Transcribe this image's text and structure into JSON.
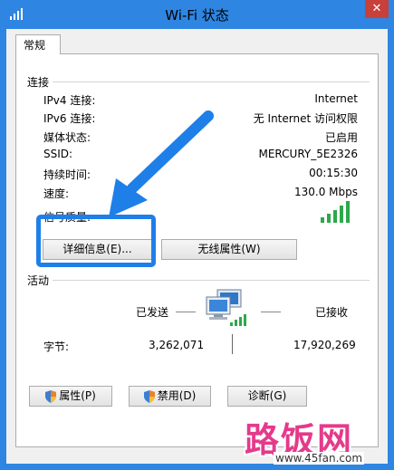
{
  "window": {
    "title": "Wi-Fi 状态",
    "close_glyph": "✕",
    "accent_color": "#2f86e2"
  },
  "tab": {
    "label": "常规"
  },
  "connection": {
    "group_title": "连接",
    "rows": [
      {
        "label": "IPv4 连接:",
        "value": "Internet"
      },
      {
        "label": "IPv6 连接:",
        "value": "无 Internet 访问权限"
      },
      {
        "label": "媒体状态:",
        "value": "已启用"
      },
      {
        "label": "SSID:",
        "value": "MERCURY_5E2326"
      },
      {
        "label": "持续时间:",
        "value": "00:15:30"
      },
      {
        "label": "速度:",
        "value": "130.0 Mbps"
      }
    ],
    "signal_label": "信号质量:",
    "signal_bars": 5
  },
  "buttons": {
    "details": "详细信息(E)...",
    "wireless_props": "无线属性(W)",
    "properties": "属性(P)",
    "disable": "禁用(D)",
    "diagnose": "诊断(G)"
  },
  "activity": {
    "group_title": "活动",
    "sent_label": "已发送",
    "received_label": "已接收",
    "bytes_label": "字节:",
    "bytes_sent": "3,262,071",
    "bytes_received": "17,920,269"
  },
  "watermark": {
    "brand": "路饭网",
    "url": "www.45fan.com"
  },
  "colors": {
    "highlight": "#1f7fe8",
    "signal": "#2ea84a",
    "watermark": "#e53a8b"
  }
}
